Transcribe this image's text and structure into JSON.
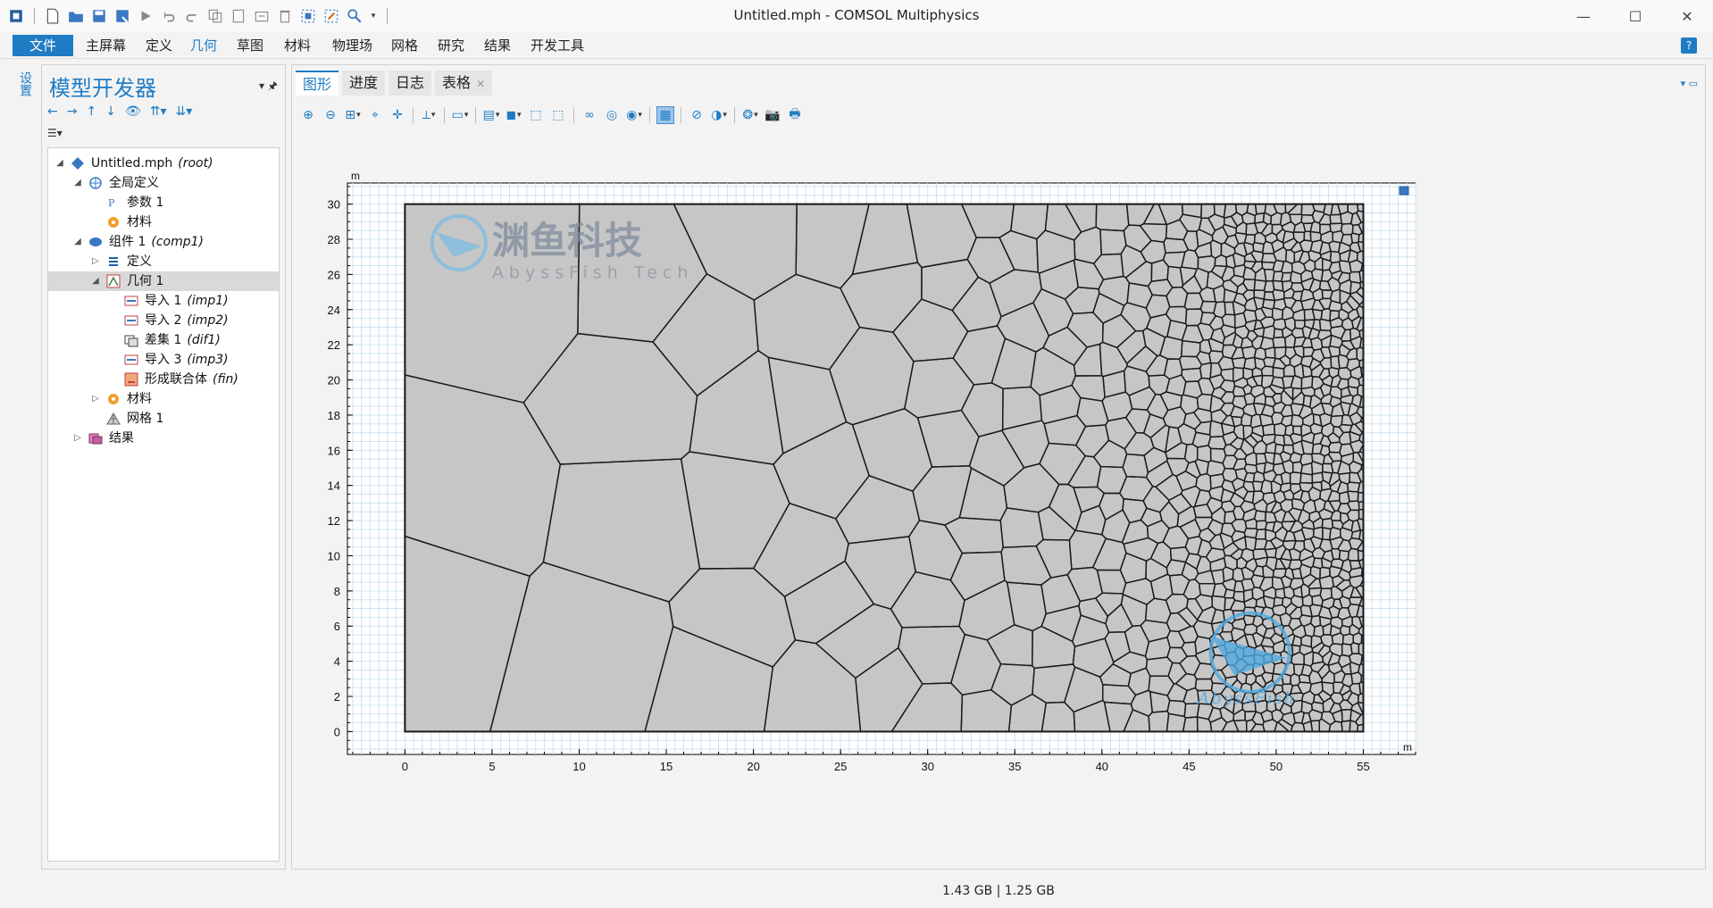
{
  "window": {
    "title": "Untitled.mph - COMSOL Multiphysics",
    "minimize": "—",
    "maximize": "☐",
    "close": "✕"
  },
  "menu": {
    "file": "文件",
    "items": [
      "主屏幕",
      "定义",
      "几何",
      "草图",
      "材料",
      "物理场",
      "网格",
      "研究",
      "结果",
      "开发工具"
    ],
    "active": "几何",
    "help": "?"
  },
  "side_strip": {
    "label": "设置"
  },
  "model_builder": {
    "title": "模型开发器",
    "tree": [
      {
        "label": "Untitled.mph",
        "tag": "(root)",
        "icon": "root-diamond-icon"
      },
      {
        "label": "全局定义",
        "tag": "",
        "icon": "globe-icon"
      },
      {
        "label": "参数 1",
        "tag": "",
        "icon": "parameters-icon"
      },
      {
        "label": "材料",
        "tag": "",
        "icon": "material-icon"
      },
      {
        "label": "组件 1",
        "tag": "(comp1)",
        "icon": "component-icon"
      },
      {
        "label": "定义",
        "tag": "",
        "icon": "definitions-icon"
      },
      {
        "label": "几何 1",
        "tag": "",
        "icon": "geometry-icon"
      },
      {
        "label": "导入 1",
        "tag": "(imp1)",
        "icon": "import-icon"
      },
      {
        "label": "导入 2",
        "tag": "(imp2)",
        "icon": "import-icon"
      },
      {
        "label": "差集 1",
        "tag": "(dif1)",
        "icon": "difference-icon"
      },
      {
        "label": "导入 3",
        "tag": "(imp3)",
        "icon": "import-icon"
      },
      {
        "label": "形成联合体",
        "tag": "(fin)",
        "icon": "form-union-icon"
      },
      {
        "label": "材料",
        "tag": "",
        "icon": "material-icon"
      },
      {
        "label": "网格 1",
        "tag": "",
        "icon": "mesh-icon"
      },
      {
        "label": "结果",
        "tag": "",
        "icon": "results-icon"
      }
    ]
  },
  "graphics": {
    "tabs": [
      "图形",
      "进度",
      "日志",
      "表格"
    ],
    "active_tab": "图形",
    "unit_label": "m",
    "watermark_main": "渊鱼科技",
    "watermark_sub": "AbyssFish Tech",
    "watermark_small": "AbyssFish"
  },
  "chart_data": {
    "type": "voronoi-geometry",
    "xlim": [
      -3.3,
      58
    ],
    "ylim": [
      -1.3,
      31.2
    ],
    "x_ticks": [
      0,
      5,
      10,
      15,
      20,
      25,
      30,
      35,
      40,
      45,
      50,
      55
    ],
    "y_ticks": [
      0,
      2,
      4,
      6,
      8,
      10,
      12,
      14,
      16,
      18,
      20,
      22,
      24,
      26,
      28,
      30
    ],
    "domain": {
      "x": [
        0,
        55
      ],
      "y": [
        0,
        30
      ]
    },
    "grid": true,
    "fill_color": "#c6c6c6",
    "edge_color": "#1a1a1a"
  },
  "status": {
    "memory": "1.43 GB | 1.25 GB"
  }
}
